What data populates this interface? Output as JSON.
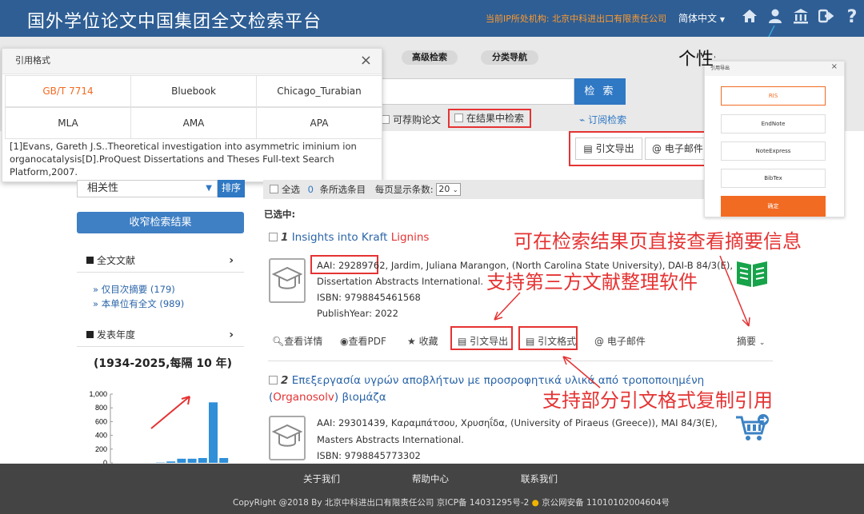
{
  "header": {
    "site_title": "国外学位论文中国集团全文检索平台",
    "ip_info": "当前IP所处机构: 北京中科进出口有限责任公司",
    "language": "简体中文",
    "icons": [
      "home-icon",
      "user-icon",
      "institution-icon",
      "logout-icon",
      "help-icon"
    ],
    "help_glyph": "?"
  },
  "search": {
    "advanced_label": "高级检索",
    "category_nav_label": "分类导航",
    "search_button": "检 索",
    "option_purchasable": "可荐购论文",
    "option_in_results": "在结果中检索",
    "subscribe_label": "订阅检索"
  },
  "toolbar_top": {
    "export_label": "引文导出",
    "email_label": "电子邮件"
  },
  "cite_popup": {
    "title": "引用格式",
    "close": "×",
    "formats": [
      "GB/T 7714",
      "Bluebook",
      "Chicago_Turabian",
      "MLA",
      "AMA",
      "APA"
    ],
    "active_format": "GB/T 7714",
    "citation_text": "[1]Evans, Gareth J.S..Theoretical investigation into asymmetric iminium ion organocatalysis[D].ProQuest Dissertations and Theses Full-text Search Platform,2007."
  },
  "sidebar": {
    "sort_value": "相关性",
    "sort_button": "排序",
    "narrow_button": "收窄检索结果",
    "facet_fulltext": "全文文献",
    "fulltext_items": [
      {
        "label": "» 仅目次摘要",
        "count": "(179)"
      },
      {
        "label": "» 本单位有全文",
        "count": "(989)"
      }
    ],
    "facet_year": "发表年度",
    "year_range": "(1934-2025,每隔 10 年)"
  },
  "chart_data": {
    "type": "bar",
    "yticks": [
      "1,000",
      "800",
      "600",
      "400",
      "200",
      "0"
    ],
    "ylim": [
      0,
      1000
    ],
    "values": [
      5,
      20,
      60,
      60,
      70,
      880,
      70
    ],
    "bar_color": "#2f8fd8"
  },
  "results_bar": {
    "select_all": "全选",
    "selected_count": "0",
    "selected_suffix": "条所选条目",
    "per_page_label": "每页显示条数:",
    "per_page_value": "20"
  },
  "selected_label": "已选中:",
  "results": [
    {
      "num": "1",
      "title_pre": "Insights into Kraft ",
      "title_hl": "Lignins",
      "aai": "AAI: 29289762,",
      "authors": " Jardim, Juliana Marangon, (North Carolina State University), DAI-B 84/3(E),",
      "line2": "Dissertation Abstracts International.",
      "isbn": "ISBN: 9798845461568",
      "year": "PublishYear: 2022"
    },
    {
      "num": "2",
      "title_pre": "Επεξεργασία υγρών αποβλήτων με προσροφητικά υλικά από τροποποιημένη",
      "title_open": "(",
      "title_hl": "Organosolv",
      "title_post": ") βιομάζα",
      "aai": "AAI: 29301439, Καραμπάτσου, Χρυσηΐδα, (University of Piraeus (Greece)), MAI 84/3(E),",
      "line2": "Masters Abstracts International.",
      "isbn": "ISBN: 9798845773302"
    }
  ],
  "actions": {
    "details": "查看详情",
    "pdf": "查看PDF",
    "favorite": "收藏",
    "export": "引文导出",
    "cite": "引文格式",
    "email": "电子邮件",
    "abstract": "摘要"
  },
  "export_popup": {
    "title": "引用导出",
    "close": "×",
    "options": [
      "RIS",
      "EndNote",
      "NoteExpress",
      "BibTex"
    ],
    "confirm": "确定"
  },
  "annotations": {
    "register": "个性化账号注册",
    "abstract_view": "可在检索结果页直接查看摘要信息",
    "third_party": "支持第三方文献整理软件",
    "cite_copy": "支持部分引文格式复制引用"
  },
  "footer": {
    "about": "关于我们",
    "help": "帮助中心",
    "contact": "联系我们",
    "copyright": "CopyRight @2018 By 北京中科进出口有限责任公司 京ICP备 14031295号-2",
    "police": "京公网安备 11010102004604号"
  },
  "colors": {
    "header_bg": "#2e5e94",
    "accent_blue": "#2f78c4",
    "annotation_red": "#e53333",
    "orange": "#f26b22",
    "ip_text": "#ff9a2e"
  }
}
